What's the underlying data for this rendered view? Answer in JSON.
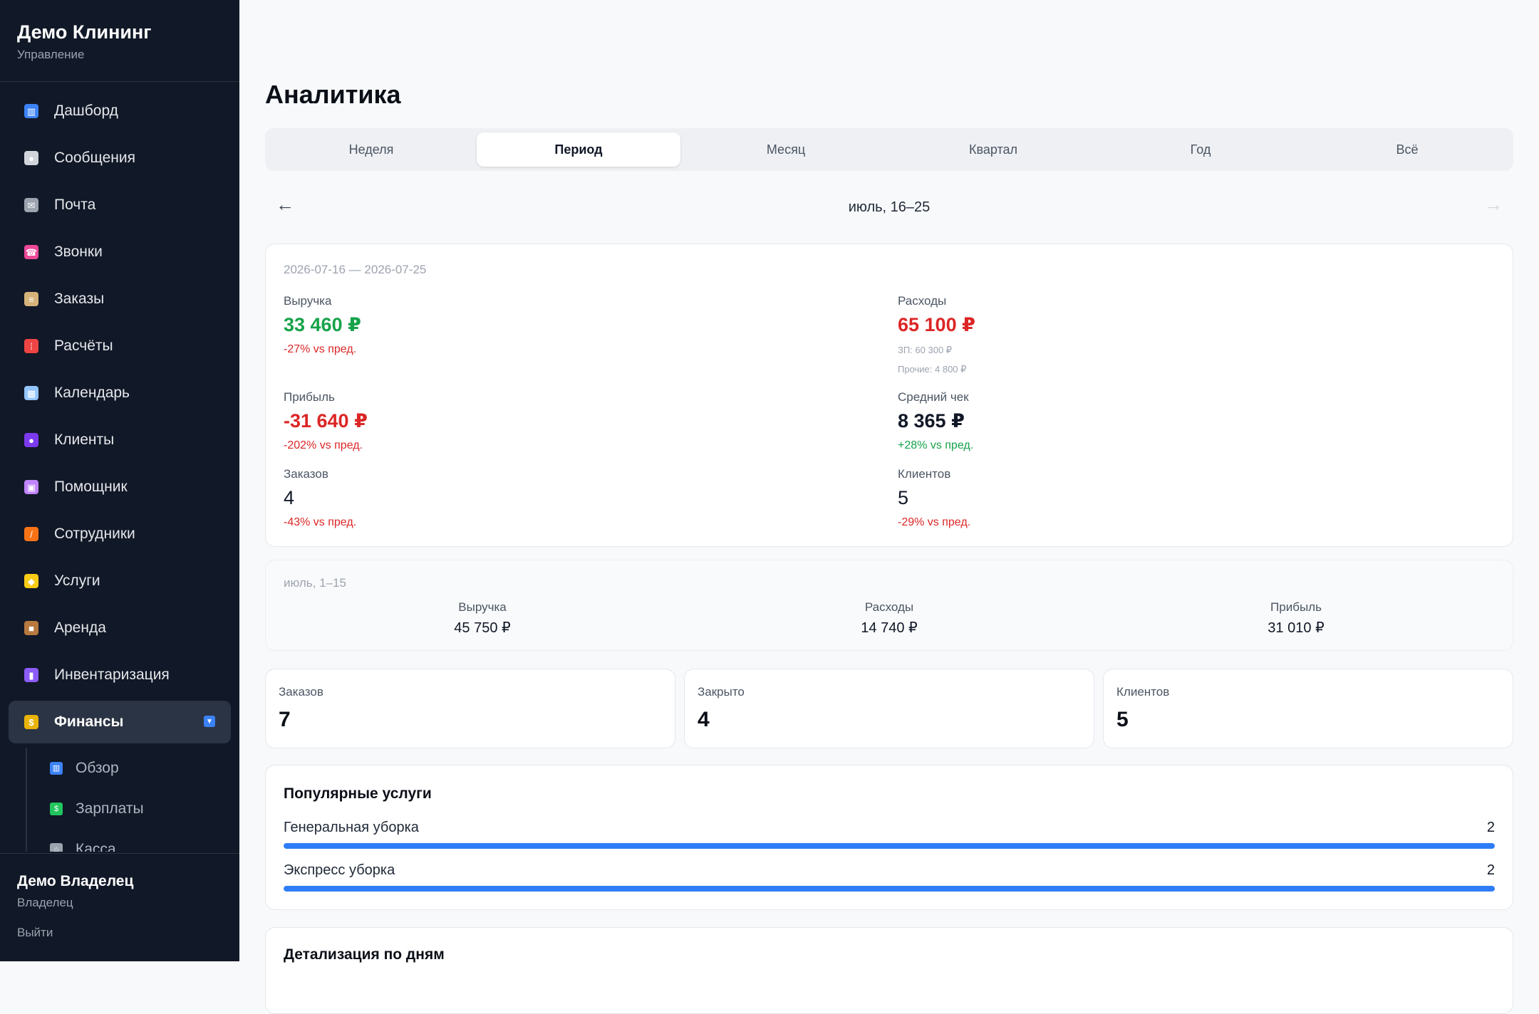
{
  "sidebar": {
    "brand_title": "Демо Клининг",
    "brand_subtitle": "Управление",
    "items": [
      {
        "label": "Дашборд",
        "icon": "chart-icon",
        "color": "#3b82f6"
      },
      {
        "label": "Сообщения",
        "icon": "speech-bubble-icon",
        "color": "#d1d5db"
      },
      {
        "label": "Почта",
        "icon": "mail-icon",
        "color": "#9ca3af"
      },
      {
        "label": "Звонки",
        "icon": "phone-icon",
        "color": "#ec4899"
      },
      {
        "label": "Заказы",
        "icon": "clipboard-icon",
        "color": "#d6b37a"
      },
      {
        "label": "Расчёты",
        "icon": "abacus-icon",
        "color": "#ef4444"
      },
      {
        "label": "Календарь",
        "icon": "calendar-icon",
        "color": "#93c5fd"
      },
      {
        "label": "Клиенты",
        "icon": "people-icon",
        "color": "#7c3aed"
      },
      {
        "label": "Помощник",
        "icon": "robot-icon",
        "color": "#c084fc"
      },
      {
        "label": "Сотрудники",
        "icon": "broom-icon",
        "color": "#f97316"
      },
      {
        "label": "Услуги",
        "icon": "tag-icon",
        "color": "#facc15"
      },
      {
        "label": "Аренда",
        "icon": "box-icon",
        "color": "#b7793f"
      },
      {
        "label": "Инвентаризация",
        "icon": "column-icon",
        "color": "#8b5cf6"
      },
      {
        "label": "Финансы",
        "icon": "money-bag-icon",
        "color": "#eab308"
      }
    ],
    "sub_items": [
      {
        "label": "Обзор",
        "icon": "chart-icon",
        "color": "#3b82f6"
      },
      {
        "label": "Зарплаты",
        "icon": "cash-icon",
        "color": "#22c55e"
      },
      {
        "label": "Касса",
        "icon": "bank-icon",
        "color": "#9ca3af"
      }
    ],
    "user_name": "Демо Владелец",
    "user_role": "Владелец",
    "logout": "Выйти"
  },
  "page": {
    "title": "Аналитика",
    "tabs": [
      "Неделя",
      "Период",
      "Месяц",
      "Квартал",
      "Год",
      "Всё"
    ],
    "active_tab": "Период",
    "period_label": "июль, 16–25",
    "prev_arrow": "←",
    "next_arrow": "→"
  },
  "summary": {
    "range": "2026-07-16 — 2026-07-25",
    "revenue": {
      "label": "Выручка",
      "value": "33 460 ₽",
      "delta": "-27% vs пред."
    },
    "expenses": {
      "label": "Расходы",
      "value": "65 100 ₽",
      "salary": "ЗП: 60 300 ₽",
      "other": "Прочие: 4 800 ₽"
    },
    "profit": {
      "label": "Прибыль",
      "value": "-31 640 ₽",
      "delta": "-202% vs пред."
    },
    "avg_check": {
      "label": "Средний чек",
      "value": "8 365 ₽",
      "delta": "+28% vs пред."
    },
    "orders": {
      "label": "Заказов",
      "value": "4",
      "delta": "-43% vs пред."
    },
    "clients": {
      "label": "Клиентов",
      "value": "5",
      "delta": "-29% vs пред."
    }
  },
  "previous": {
    "range": "июль, 1–15",
    "revenue": {
      "label": "Выручка",
      "value": "45 750 ₽"
    },
    "expenses": {
      "label": "Расходы",
      "value": "14 740 ₽"
    },
    "profit": {
      "label": "Прибыль",
      "value": "31 010 ₽"
    }
  },
  "stats": [
    {
      "label": "Заказов",
      "value": "7"
    },
    {
      "label": "Закрыто",
      "value": "4"
    },
    {
      "label": "Клиентов",
      "value": "5"
    }
  ],
  "popular": {
    "title": "Популярные услуги",
    "items": [
      {
        "name": "Генеральная уборка",
        "count": "2",
        "share": 1.0
      },
      {
        "name": "Экспресс уборка",
        "count": "2",
        "share": 1.0
      }
    ]
  },
  "daily": {
    "title": "Детализация по дням"
  },
  "colors": {
    "positive": "#16a34a",
    "negative": "#dc2626",
    "accent": "#2f7df6"
  }
}
